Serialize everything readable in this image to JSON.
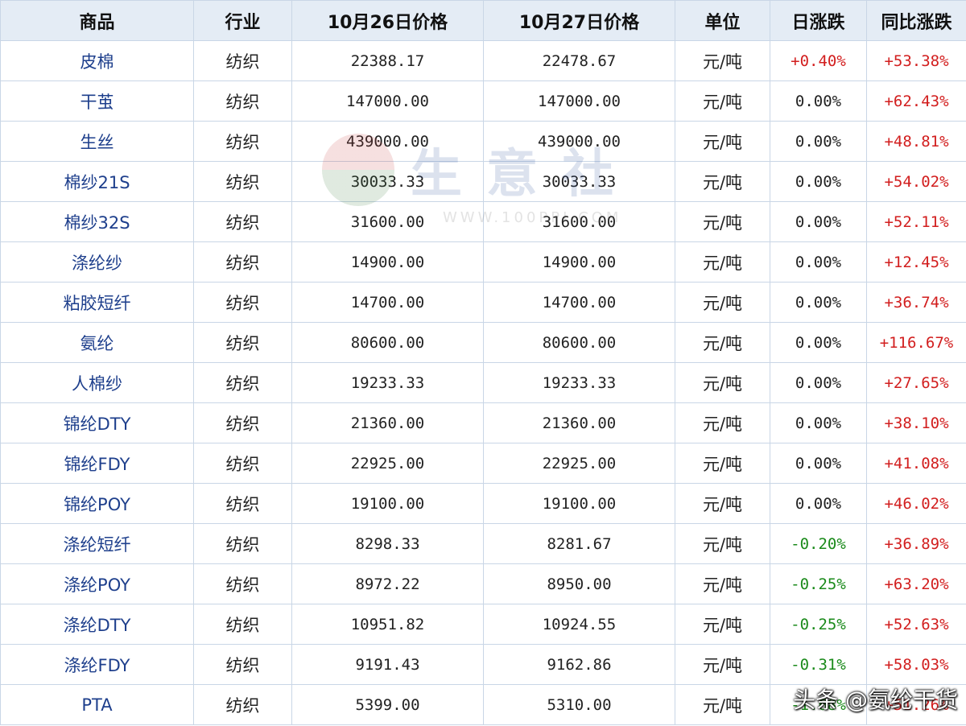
{
  "headers": [
    "商品",
    "行业",
    "10月26日价格",
    "10月27日价格",
    "单位",
    "日涨跌",
    "同比涨跌"
  ],
  "rows": [
    {
      "name": "皮棉",
      "industry": "纺织",
      "p26": "22388.17",
      "p27": "22478.67",
      "unit": "元/吨",
      "daily": "+0.40%",
      "daily_dir": "up",
      "yoy": "+53.38%"
    },
    {
      "name": "干茧",
      "industry": "纺织",
      "p26": "147000.00",
      "p27": "147000.00",
      "unit": "元/吨",
      "daily": "0.00%",
      "daily_dir": "flat",
      "yoy": "+62.43%"
    },
    {
      "name": "生丝",
      "industry": "纺织",
      "p26": "439000.00",
      "p27": "439000.00",
      "unit": "元/吨",
      "daily": "0.00%",
      "daily_dir": "flat",
      "yoy": "+48.81%"
    },
    {
      "name": "棉纱21S",
      "industry": "纺织",
      "p26": "30033.33",
      "p27": "30033.33",
      "unit": "元/吨",
      "daily": "0.00%",
      "daily_dir": "flat",
      "yoy": "+54.02%"
    },
    {
      "name": "棉纱32S",
      "industry": "纺织",
      "p26": "31600.00",
      "p27": "31600.00",
      "unit": "元/吨",
      "daily": "0.00%",
      "daily_dir": "flat",
      "yoy": "+52.11%"
    },
    {
      "name": "涤纶纱",
      "industry": "纺织",
      "p26": "14900.00",
      "p27": "14900.00",
      "unit": "元/吨",
      "daily": "0.00%",
      "daily_dir": "flat",
      "yoy": "+12.45%"
    },
    {
      "name": "粘胶短纤",
      "industry": "纺织",
      "p26": "14700.00",
      "p27": "14700.00",
      "unit": "元/吨",
      "daily": "0.00%",
      "daily_dir": "flat",
      "yoy": "+36.74%"
    },
    {
      "name": "氨纶",
      "industry": "纺织",
      "p26": "80600.00",
      "p27": "80600.00",
      "unit": "元/吨",
      "daily": "0.00%",
      "daily_dir": "flat",
      "yoy": "+116.67%"
    },
    {
      "name": "人棉纱",
      "industry": "纺织",
      "p26": "19233.33",
      "p27": "19233.33",
      "unit": "元/吨",
      "daily": "0.00%",
      "daily_dir": "flat",
      "yoy": "+27.65%"
    },
    {
      "name": "锦纶DTY",
      "industry": "纺织",
      "p26": "21360.00",
      "p27": "21360.00",
      "unit": "元/吨",
      "daily": "0.00%",
      "daily_dir": "flat",
      "yoy": "+38.10%"
    },
    {
      "name": "锦纶FDY",
      "industry": "纺织",
      "p26": "22925.00",
      "p27": "22925.00",
      "unit": "元/吨",
      "daily": "0.00%",
      "daily_dir": "flat",
      "yoy": "+41.08%"
    },
    {
      "name": "锦纶POY",
      "industry": "纺织",
      "p26": "19100.00",
      "p27": "19100.00",
      "unit": "元/吨",
      "daily": "0.00%",
      "daily_dir": "flat",
      "yoy": "+46.02%"
    },
    {
      "name": "涤纶短纤",
      "industry": "纺织",
      "p26": "8298.33",
      "p27": "8281.67",
      "unit": "元/吨",
      "daily": "-0.20%",
      "daily_dir": "down",
      "yoy": "+36.89%"
    },
    {
      "name": "涤纶POY",
      "industry": "纺织",
      "p26": "8972.22",
      "p27": "8950.00",
      "unit": "元/吨",
      "daily": "-0.25%",
      "daily_dir": "down",
      "yoy": "+63.20%"
    },
    {
      "name": "涤纶DTY",
      "industry": "纺织",
      "p26": "10951.82",
      "p27": "10924.55",
      "unit": "元/吨",
      "daily": "-0.25%",
      "daily_dir": "down",
      "yoy": "+52.63%"
    },
    {
      "name": "涤纶FDY",
      "industry": "纺织",
      "p26": "9191.43",
      "p27": "9162.86",
      "unit": "元/吨",
      "daily": "-0.31%",
      "daily_dir": "down",
      "yoy": "+58.03%"
    },
    {
      "name": "PTA",
      "industry": "纺织",
      "p26": "5399.00",
      "p27": "5310.00",
      "unit": "元/吨",
      "daily": "-1.68%",
      "daily_dir": "down",
      "yoy": "+51.26%"
    }
  ],
  "watermark": {
    "text": "生意社",
    "url": "WWW.100PPI.COM"
  },
  "credit": "头条 @氨纶干货",
  "colors": {
    "up": "#d21e1e",
    "down": "#1a8a1a",
    "header_bg": "#e4ecf5",
    "name_text": "#1e3f8c",
    "border": "#c9d6e6"
  }
}
